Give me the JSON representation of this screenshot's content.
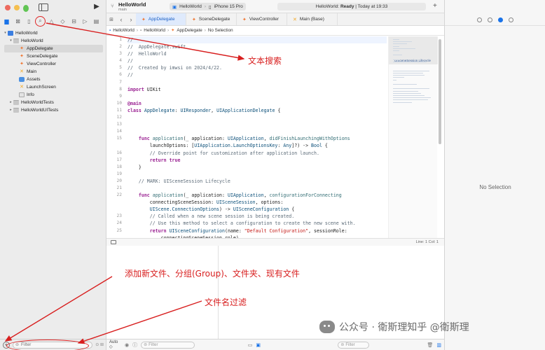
{
  "navigator": {
    "tree": [
      {
        "label": "HelloWorld",
        "kind": "proj",
        "indent": 0,
        "chev": "▾"
      },
      {
        "label": "HelloWorld",
        "kind": "folder",
        "indent": 1,
        "chev": "▾"
      },
      {
        "label": "AppDelegate",
        "kind": "swift",
        "indent": 2,
        "chev": "",
        "selected": true
      },
      {
        "label": "SceneDelegate",
        "kind": "swift",
        "indent": 2,
        "chev": ""
      },
      {
        "label": "ViewController",
        "kind": "swift",
        "indent": 2,
        "chev": ""
      },
      {
        "label": "Main",
        "kind": "sb",
        "indent": 2,
        "chev": ""
      },
      {
        "label": "Assets",
        "kind": "assets",
        "indent": 2,
        "chev": ""
      },
      {
        "label": "LaunchScreen",
        "kind": "sb",
        "indent": 2,
        "chev": ""
      },
      {
        "label": "Info",
        "kind": "plist",
        "indent": 2,
        "chev": ""
      },
      {
        "label": "HelloWorldTests",
        "kind": "folder",
        "indent": 1,
        "chev": "▸"
      },
      {
        "label": "HelloWorldUITests",
        "kind": "folder",
        "indent": 1,
        "chev": "▸"
      }
    ],
    "filter_placeholder": "Filter"
  },
  "titlebar": {
    "project": "HelloWorld",
    "branch": "main",
    "scheme_target": "HelloWorld",
    "scheme_device": "iPhone 15 Pro",
    "status_prefix": "HelloWorld:",
    "status_state": "Ready",
    "status_suffix": "| Today at 19:33"
  },
  "tabs": [
    {
      "label": "AppDelegate",
      "icon": "swift",
      "selected": true
    },
    {
      "label": "SceneDelegate",
      "icon": "swift"
    },
    {
      "label": "ViewController",
      "icon": "swift"
    },
    {
      "label": "Main (Base)",
      "icon": "sb"
    }
  ],
  "jumpbar": [
    "HelloWorld",
    "HelloWorld",
    "AppDelegate",
    "No Selection"
  ],
  "code": {
    "line_numbers": [
      "1",
      "2",
      "3",
      "4",
      "5",
      "6",
      "7",
      "8",
      "9",
      "10",
      "11",
      "12",
      "13",
      "14",
      "15",
      "",
      "16",
      "17",
      "18",
      "19",
      "20",
      "21",
      "22",
      "",
      "",
      "23",
      "24",
      "25",
      ""
    ],
    "lines": [
      [
        [
          "c",
          "//"
        ]
      ],
      [
        [
          "c",
          "//  AppDelegate.swift"
        ]
      ],
      [
        [
          "c",
          "//  HelloWorld"
        ]
      ],
      [
        [
          "c",
          "//"
        ]
      ],
      [
        [
          "c",
          "//  Created by imwsi on 2024/4/22."
        ]
      ],
      [
        [
          "c",
          "//"
        ]
      ],
      [
        [
          "p",
          ""
        ]
      ],
      [
        [
          "k",
          "import"
        ],
        [
          "p",
          " UIKit"
        ]
      ],
      [
        [
          "p",
          ""
        ]
      ],
      [
        [
          "k",
          "@main"
        ]
      ],
      [
        [
          "k",
          "class"
        ],
        [
          "p",
          " "
        ],
        [
          "t",
          "AppDelegate"
        ],
        [
          "p",
          ": "
        ],
        [
          "t",
          "UIResponder"
        ],
        [
          "p",
          ", "
        ],
        [
          "t",
          "UIApplicationDelegate"
        ],
        [
          "p",
          " {"
        ]
      ],
      [
        [
          "p",
          ""
        ]
      ],
      [
        [
          "p",
          ""
        ]
      ],
      [
        [
          "p",
          ""
        ]
      ],
      [
        [
          "p",
          "    "
        ],
        [
          "k",
          "func"
        ],
        [
          "p",
          " "
        ],
        [
          "f",
          "application"
        ],
        [
          "p",
          "(_ application: "
        ],
        [
          "t",
          "UIApplication"
        ],
        [
          "p",
          ", "
        ],
        [
          "f",
          "didFinishLaunchingWithOptions"
        ]
      ],
      [
        [
          "p",
          "        launchOptions: ["
        ],
        [
          "t",
          "UIApplication.LaunchOptionsKey"
        ],
        [
          "p",
          ": "
        ],
        [
          "t",
          "Any"
        ],
        [
          "p",
          "]?) -> "
        ],
        [
          "t",
          "Bool"
        ],
        [
          "p",
          " {"
        ]
      ],
      [
        [
          "p",
          "        "
        ],
        [
          "c",
          "// Override point for customization after application launch."
        ]
      ],
      [
        [
          "p",
          "        "
        ],
        [
          "k",
          "return"
        ],
        [
          "p",
          " "
        ],
        [
          "k",
          "true"
        ]
      ],
      [
        [
          "p",
          "    }"
        ]
      ],
      [
        [
          "p",
          ""
        ]
      ],
      [
        [
          "p",
          "    "
        ],
        [
          "c",
          "// MARK: UISceneSession Lifecycle"
        ]
      ],
      [
        [
          "p",
          ""
        ]
      ],
      [
        [
          "p",
          "    "
        ],
        [
          "k",
          "func"
        ],
        [
          "p",
          " "
        ],
        [
          "f",
          "application"
        ],
        [
          "p",
          "(_ application: "
        ],
        [
          "t",
          "UIApplication"
        ],
        [
          "p",
          ", "
        ],
        [
          "f",
          "configurationForConnecting"
        ]
      ],
      [
        [
          "p",
          "        connectingSceneSession: "
        ],
        [
          "t",
          "UISceneSession"
        ],
        [
          "p",
          ", options:"
        ]
      ],
      [
        [
          "p",
          "        "
        ],
        [
          "t",
          "UIScene.ConnectionOptions"
        ],
        [
          "p",
          ") -> "
        ],
        [
          "t",
          "UISceneConfiguration"
        ],
        [
          "p",
          " {"
        ]
      ],
      [
        [
          "p",
          "        "
        ],
        [
          "c",
          "// Called when a new scene session is being created."
        ]
      ],
      [
        [
          "p",
          "        "
        ],
        [
          "c",
          "// Use this method to select a configuration to create the new scene with."
        ]
      ],
      [
        [
          "p",
          "        "
        ],
        [
          "k",
          "return"
        ],
        [
          "p",
          " "
        ],
        [
          "t",
          "UISceneConfiguration"
        ],
        [
          "p",
          "(name: "
        ],
        [
          "s",
          "\"Default Configuration\""
        ],
        [
          "p",
          ", sessionRole:"
        ]
      ],
      [
        [
          "p",
          "            connectingSceneSession.role)"
        ]
      ]
    ]
  },
  "minimap_label": "UISceneSession Lifecycle",
  "editor_status": {
    "linecol": "Line: 1  Col: 1"
  },
  "editor_bottom": {
    "auto_label": "Auto ◇",
    "filter_placeholder": "Filter"
  },
  "inspector": {
    "empty_label": "No Selection"
  },
  "annotations": {
    "search": "文本搜索",
    "add": "添加新文件、分组(Group)、文件夹、现有文件",
    "filter": "文件名过滤",
    "watermark": "公众号 · 衛斯理知乎 @衛斯理"
  },
  "colors": {
    "accent": "#1a73e8",
    "annotation": "#d81f1f"
  }
}
